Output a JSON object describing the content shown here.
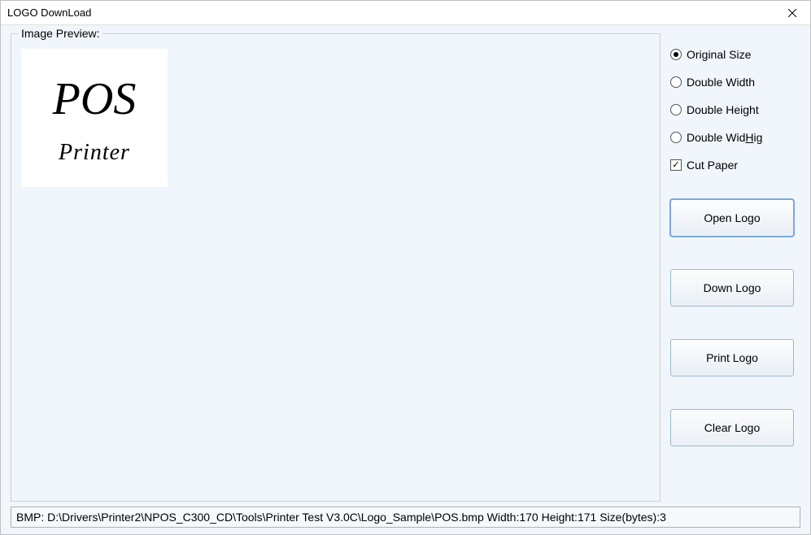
{
  "window": {
    "title": "LOGO DownLoad"
  },
  "preview": {
    "legend": "Image Preview:",
    "logo_line1": "POS",
    "logo_line2": "Printer"
  },
  "options": {
    "radios": [
      {
        "label": "Original Size",
        "selected": true
      },
      {
        "label": "Double Width",
        "selected": false
      },
      {
        "label": "Double Height",
        "selected": false
      },
      {
        "label_pre": "Double Wid",
        "label_u": "H",
        "label_post": "ig",
        "selected": false
      }
    ],
    "cut_paper": {
      "label": "Cut Paper",
      "checked": true
    }
  },
  "buttons": {
    "open": "Open Logo",
    "down": "Down Logo",
    "print": "Print Logo",
    "clear": "Clear Logo"
  },
  "status": {
    "prefix": "BMP: ",
    "path": "D:\\Drivers\\Printer2\\NPOS_C300_CD\\Tools\\Printer Test V3.0C\\Logo_Sample\\POS.bmp",
    "width_label": "  Width:",
    "width": "170",
    "height_label": "  Height:",
    "height": "171",
    "size_label": "  Size(bytes):",
    "size": "3"
  }
}
